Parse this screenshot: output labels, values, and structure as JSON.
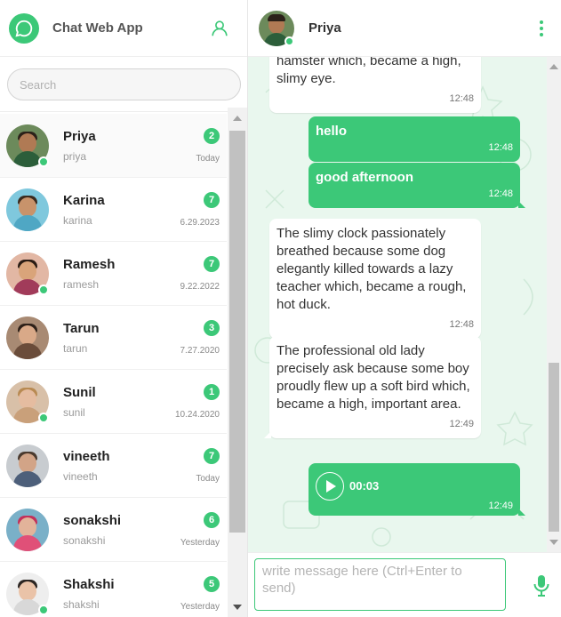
{
  "app": {
    "title": "Chat Web App"
  },
  "search": {
    "placeholder": "Search"
  },
  "contacts": [
    {
      "name": "Priya",
      "username": "priya",
      "unread": "2",
      "date": "Today",
      "online": true,
      "skin": "#b07a54",
      "hair": "#2b2119",
      "shirt": "#2c5e3a",
      "bg": "#6c8a5b"
    },
    {
      "name": "Karina",
      "username": "karina",
      "unread": "7",
      "date": "6.29.2023",
      "online": false,
      "skin": "#c8936b",
      "hair": "#3a2a1e",
      "shirt": "#4fa7c4",
      "bg": "#7fc8dd"
    },
    {
      "name": "Ramesh",
      "username": "ramesh",
      "unread": "7",
      "date": "9.22.2022",
      "online": true,
      "skin": "#d9a47a",
      "hair": "#2a1c14",
      "shirt": "#a13b5a",
      "bg": "#e2b7a4"
    },
    {
      "name": "Tarun",
      "username": "tarun",
      "unread": "3",
      "date": "7.27.2020",
      "online": false,
      "skin": "#d9a988",
      "hair": "#2d2018",
      "shirt": "#6a4c3a",
      "bg": "#a88a73"
    },
    {
      "name": "Sunil",
      "username": "sunil",
      "unread": "1",
      "date": "10.24.2020",
      "online": true,
      "skin": "#e5bca0",
      "hair": "#b88a52",
      "shirt": "#c9a07a",
      "bg": "#d8c0a8"
    },
    {
      "name": "vineeth",
      "username": "vineeth",
      "unread": "7",
      "date": "Today",
      "online": false,
      "skin": "#d2a487",
      "hair": "#4a3a2e",
      "shirt": "#4d5f7a",
      "bg": "#c8ccd0"
    },
    {
      "name": "sonakshi",
      "username": "sonakshi",
      "unread": "6",
      "date": "Yesterday",
      "online": false,
      "skin": "#e2b39a",
      "hair": "#c2305a",
      "shirt": "#e05078",
      "bg": "#7ab0c8"
    },
    {
      "name": "Shakshi",
      "username": "shakshi",
      "unread": "5",
      "date": "Yesterday",
      "online": true,
      "skin": "#eac3a8",
      "hair": "#2b2522",
      "shirt": "#d8d8d8",
      "bg": "#eeeeee"
    }
  ],
  "chat": {
    "name": "Priya",
    "online": true,
    "messages": [
      {
        "dir": "in",
        "text": "hamster which, became a high, slimy eye.",
        "time": "12:48"
      },
      {
        "dir": "out",
        "text": "hello",
        "time": "12:48"
      },
      {
        "dir": "out",
        "text": "good afternoon",
        "time": "12:48"
      },
      {
        "dir": "in",
        "text": "The slimy clock passionately breathed because some dog elegantly killed towards a lazy teacher which, became a rough, hot duck.",
        "time": "12:48"
      },
      {
        "dir": "in",
        "text": "The professional old lady precisely ask because some boy proudly flew up a soft bird which, became a high, important area.",
        "time": "12:49"
      },
      {
        "dir": "out",
        "type": "voice",
        "duration": "00:03",
        "time": "12:49"
      }
    ]
  },
  "composer": {
    "placeholder": "write message here (Ctrl+Enter to send)"
  },
  "colors": {
    "accent": "#3cc878",
    "chat_bg": "#e9f7ee"
  },
  "icons": {
    "logo": "chat-bubble-icon",
    "profile": "user-icon",
    "menu": "kebab-menu-icon",
    "send_voice": "microphone-icon",
    "play": "play-icon"
  }
}
